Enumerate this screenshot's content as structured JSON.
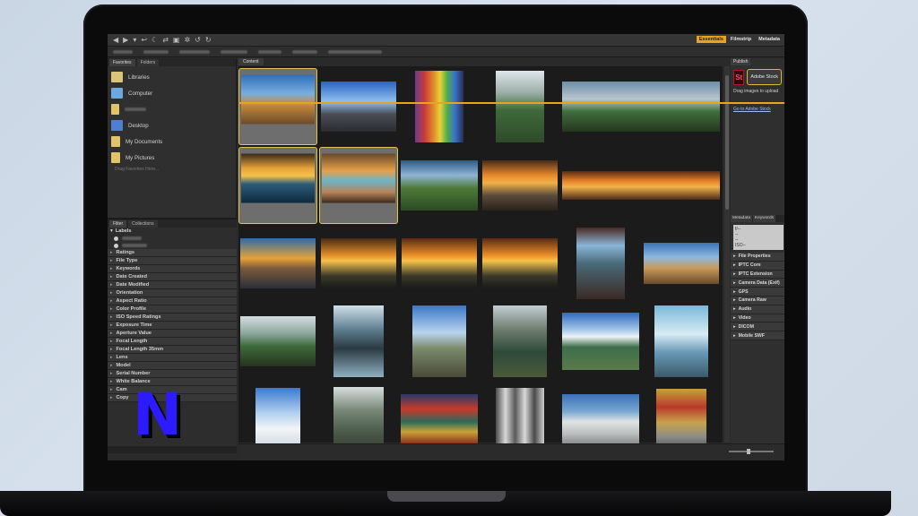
{
  "workspaces": {
    "items": [
      "Essentials",
      "Filmstrip",
      "Metadata"
    ],
    "active": "Essentials"
  },
  "left_panel": {
    "tabs": [
      "Favorites",
      "Folders"
    ],
    "favorites": [
      {
        "label": "Libraries",
        "icon": "libraries-icon",
        "color": "#d9c47a"
      },
      {
        "label": "Computer",
        "icon": "computer-icon",
        "color": "#6da8e0"
      },
      {
        "label": "",
        "icon": "user-folder-icon",
        "color": "#e2c36a"
      },
      {
        "label": "Desktop",
        "icon": "desktop-icon",
        "color": "#4f7fd1"
      },
      {
        "label": "My Documents",
        "icon": "documents-folder-icon",
        "color": "#e2c36a"
      },
      {
        "label": "My Pictures",
        "icon": "pictures-folder-icon",
        "color": "#e2c36a"
      }
    ],
    "favorites_hint": "Drag Favorites Here..."
  },
  "filter_panel": {
    "tabs": [
      "Filter",
      "Collections"
    ],
    "labels_header": "Labels",
    "rows": [
      "Ratings",
      "File Type",
      "Keywords",
      "Date Created",
      "Date Modified",
      "Orientation",
      "Aspect Ratio",
      "Color Profile",
      "ISO Speed Ratings",
      "Exposure Time",
      "Aperture Value",
      "Focal Length",
      "Focal Length 35mm",
      "Lens",
      "Model",
      "Serial Number",
      "White Balance",
      "Cam",
      "Copy"
    ]
  },
  "content": {
    "tab": "Content"
  },
  "right_panel": {
    "publish_tab": "Publish",
    "stock_logo": "St",
    "stock_button": "Adobe Stock",
    "stock_text": "Drag images to upload",
    "stock_link": "Go to Adobe Stock",
    "meta_tabs": [
      "Metadata",
      "Keywords"
    ],
    "meta_box": [
      "f/--",
      "--",
      "--",
      "ISO--"
    ],
    "meta_rows": [
      "File Properties",
      "IPTC Core",
      "IPTC Extension",
      "Camera Data (Exif)",
      "GPS",
      "Camera Raw",
      "Audio",
      "Video",
      "DICOM",
      "Mobile SWF"
    ]
  },
  "overlay": {
    "logo_letter": "N",
    "accent": "#e8a320"
  }
}
